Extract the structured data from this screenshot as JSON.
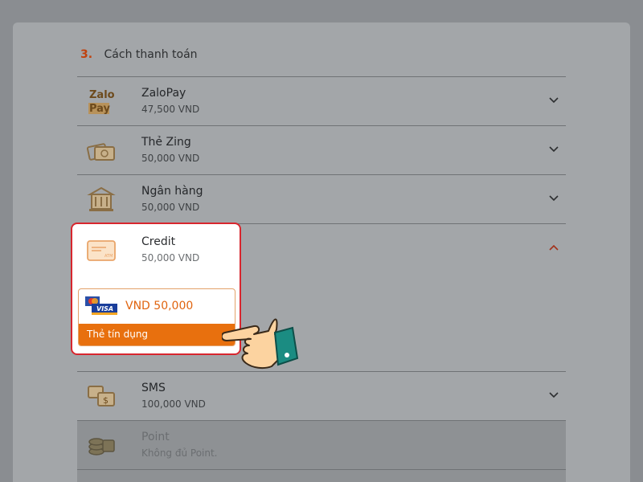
{
  "section": {
    "number": "3.",
    "title": "Cách thanh toán"
  },
  "methods": [
    {
      "name": "ZaloPay",
      "price": "47,500 VND",
      "icon": "zalopay-icon"
    },
    {
      "name": "Thẻ Zing",
      "price": "50,000 VND",
      "icon": "zing-card-icon"
    },
    {
      "name": "Ngân hàng",
      "price": "50,000 VND",
      "icon": "bank-icon"
    },
    {
      "name": "Credit",
      "price": "50,000 VND",
      "icon": "credit-card-icon"
    },
    {
      "name": "SMS",
      "price": "100,000 VND",
      "icon": "sms-icon"
    },
    {
      "name": "Point",
      "price": "Không đủ Point.",
      "icon": "coins-icon"
    }
  ],
  "credit_option": {
    "amount": "VND 50,000",
    "label": "Thẻ tín dụng",
    "icon": "mastercard-visa-icon"
  },
  "zalopay_logo": {
    "line1": "Zalo",
    "line2": "Pay"
  },
  "colors": {
    "accent": "#e8700e",
    "highlight_border": "#d8262e",
    "section_number": "#c0420e"
  }
}
